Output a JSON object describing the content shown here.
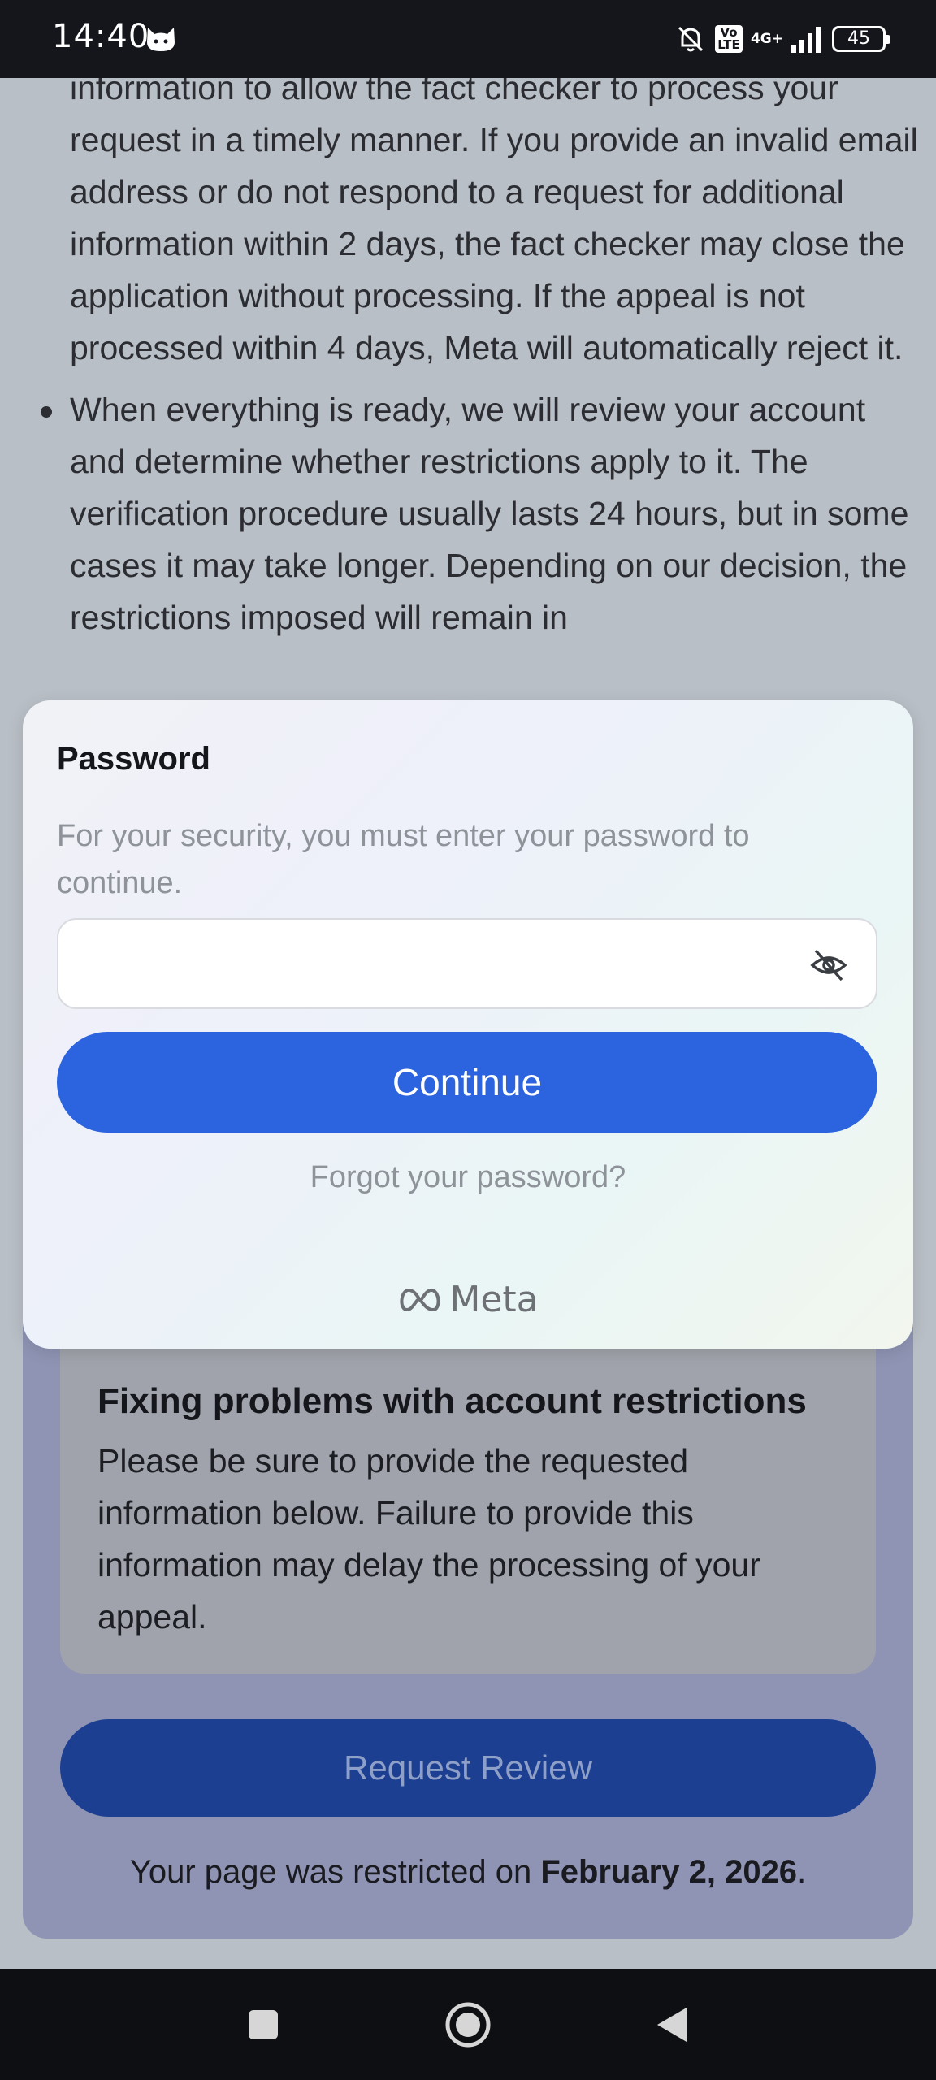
{
  "status_bar": {
    "time": "14:40",
    "volte": "Vo LTE",
    "network": "4G+",
    "battery": "45",
    "icons": [
      "cat-icon",
      "bell-off-icon",
      "volte-icon",
      "signal-icon",
      "battery-icon"
    ]
  },
  "background": {
    "paragraphs": [
      "information to allow the fact checker to process your request in a timely manner. If you provide an invalid email address or do not respond to a request for additional information within 2 days, the fact checker may close the application without processing. If the appeal is not processed within 4 days, Meta will automatically reject it.",
      "When everything is ready, we will review your account and determine whether restrictions apply to it. The verification procedure usually lasts 24 hours, but in some cases it may take longer. Depending on our decision, the restrictions imposed will remain in"
    ],
    "fix_title": "Fixing problems with account restrictions",
    "fix_text": "Please be sure to provide the requested information below. Failure to provide this information may delay the processing of your appeal.",
    "review_button": "Request Review",
    "restricted_prefix": "Your page was restricted on ",
    "restricted_date": "February 2, 2026",
    "restricted_suffix": "."
  },
  "dialog": {
    "title": "Password",
    "subtitle": "For your security, you must enter your password to continue.",
    "password_value": "",
    "password_placeholder": "",
    "continue_label": "Continue",
    "forgot_label": "Forgot your password?",
    "brand": "Meta"
  },
  "colors": {
    "accent": "#2c63de",
    "review_button": "#1c3f92",
    "muted_text": "#8e9299"
  }
}
